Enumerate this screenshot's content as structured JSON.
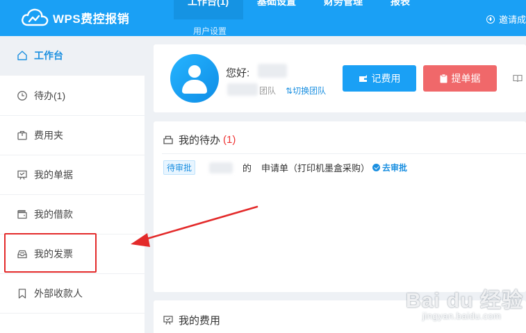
{
  "header": {
    "app_name": "WPS费控报销",
    "nav": [
      {
        "label": "工作台(1)",
        "active": true
      },
      {
        "label": "基础设置"
      },
      {
        "label": "财务管理"
      },
      {
        "label": "报表"
      }
    ],
    "nav_sub": "用户设置",
    "invite_label": "邀请成"
  },
  "sidebar": {
    "items": [
      {
        "label": "工作台",
        "icon": "home-icon",
        "active": true
      },
      {
        "label": "待办(1)",
        "icon": "clock-icon"
      },
      {
        "label": "费用夹",
        "icon": "briefcase-icon"
      },
      {
        "label": "我的单据",
        "icon": "document-board-icon"
      },
      {
        "label": "我的借款",
        "icon": "wallet-icon"
      },
      {
        "label": "我的发票",
        "icon": "inbox-icon"
      },
      {
        "label": "外部收款人",
        "icon": "bookmark-icon"
      }
    ]
  },
  "profile": {
    "greeting": "您好:",
    "team_suffix": "团队",
    "switch_team": "切换团队",
    "record_expense": "记费用",
    "submit_document": "提单据"
  },
  "todo": {
    "title": "我的待办",
    "count": "(1)",
    "row": {
      "badge": "待审批",
      "connector": "的",
      "text": "申请单（打印机墨盒采购）",
      "action": "去审批"
    }
  },
  "expenses": {
    "title": "我的费用"
  },
  "watermark": {
    "main": "Bai du 经验",
    "sub": "jingyan.baidu.com"
  },
  "colors": {
    "brand_blue": "#1aa0f5",
    "danger_red": "#f0686a",
    "highlight_red": "#e32a2a",
    "link_blue": "#1a8fe0"
  }
}
